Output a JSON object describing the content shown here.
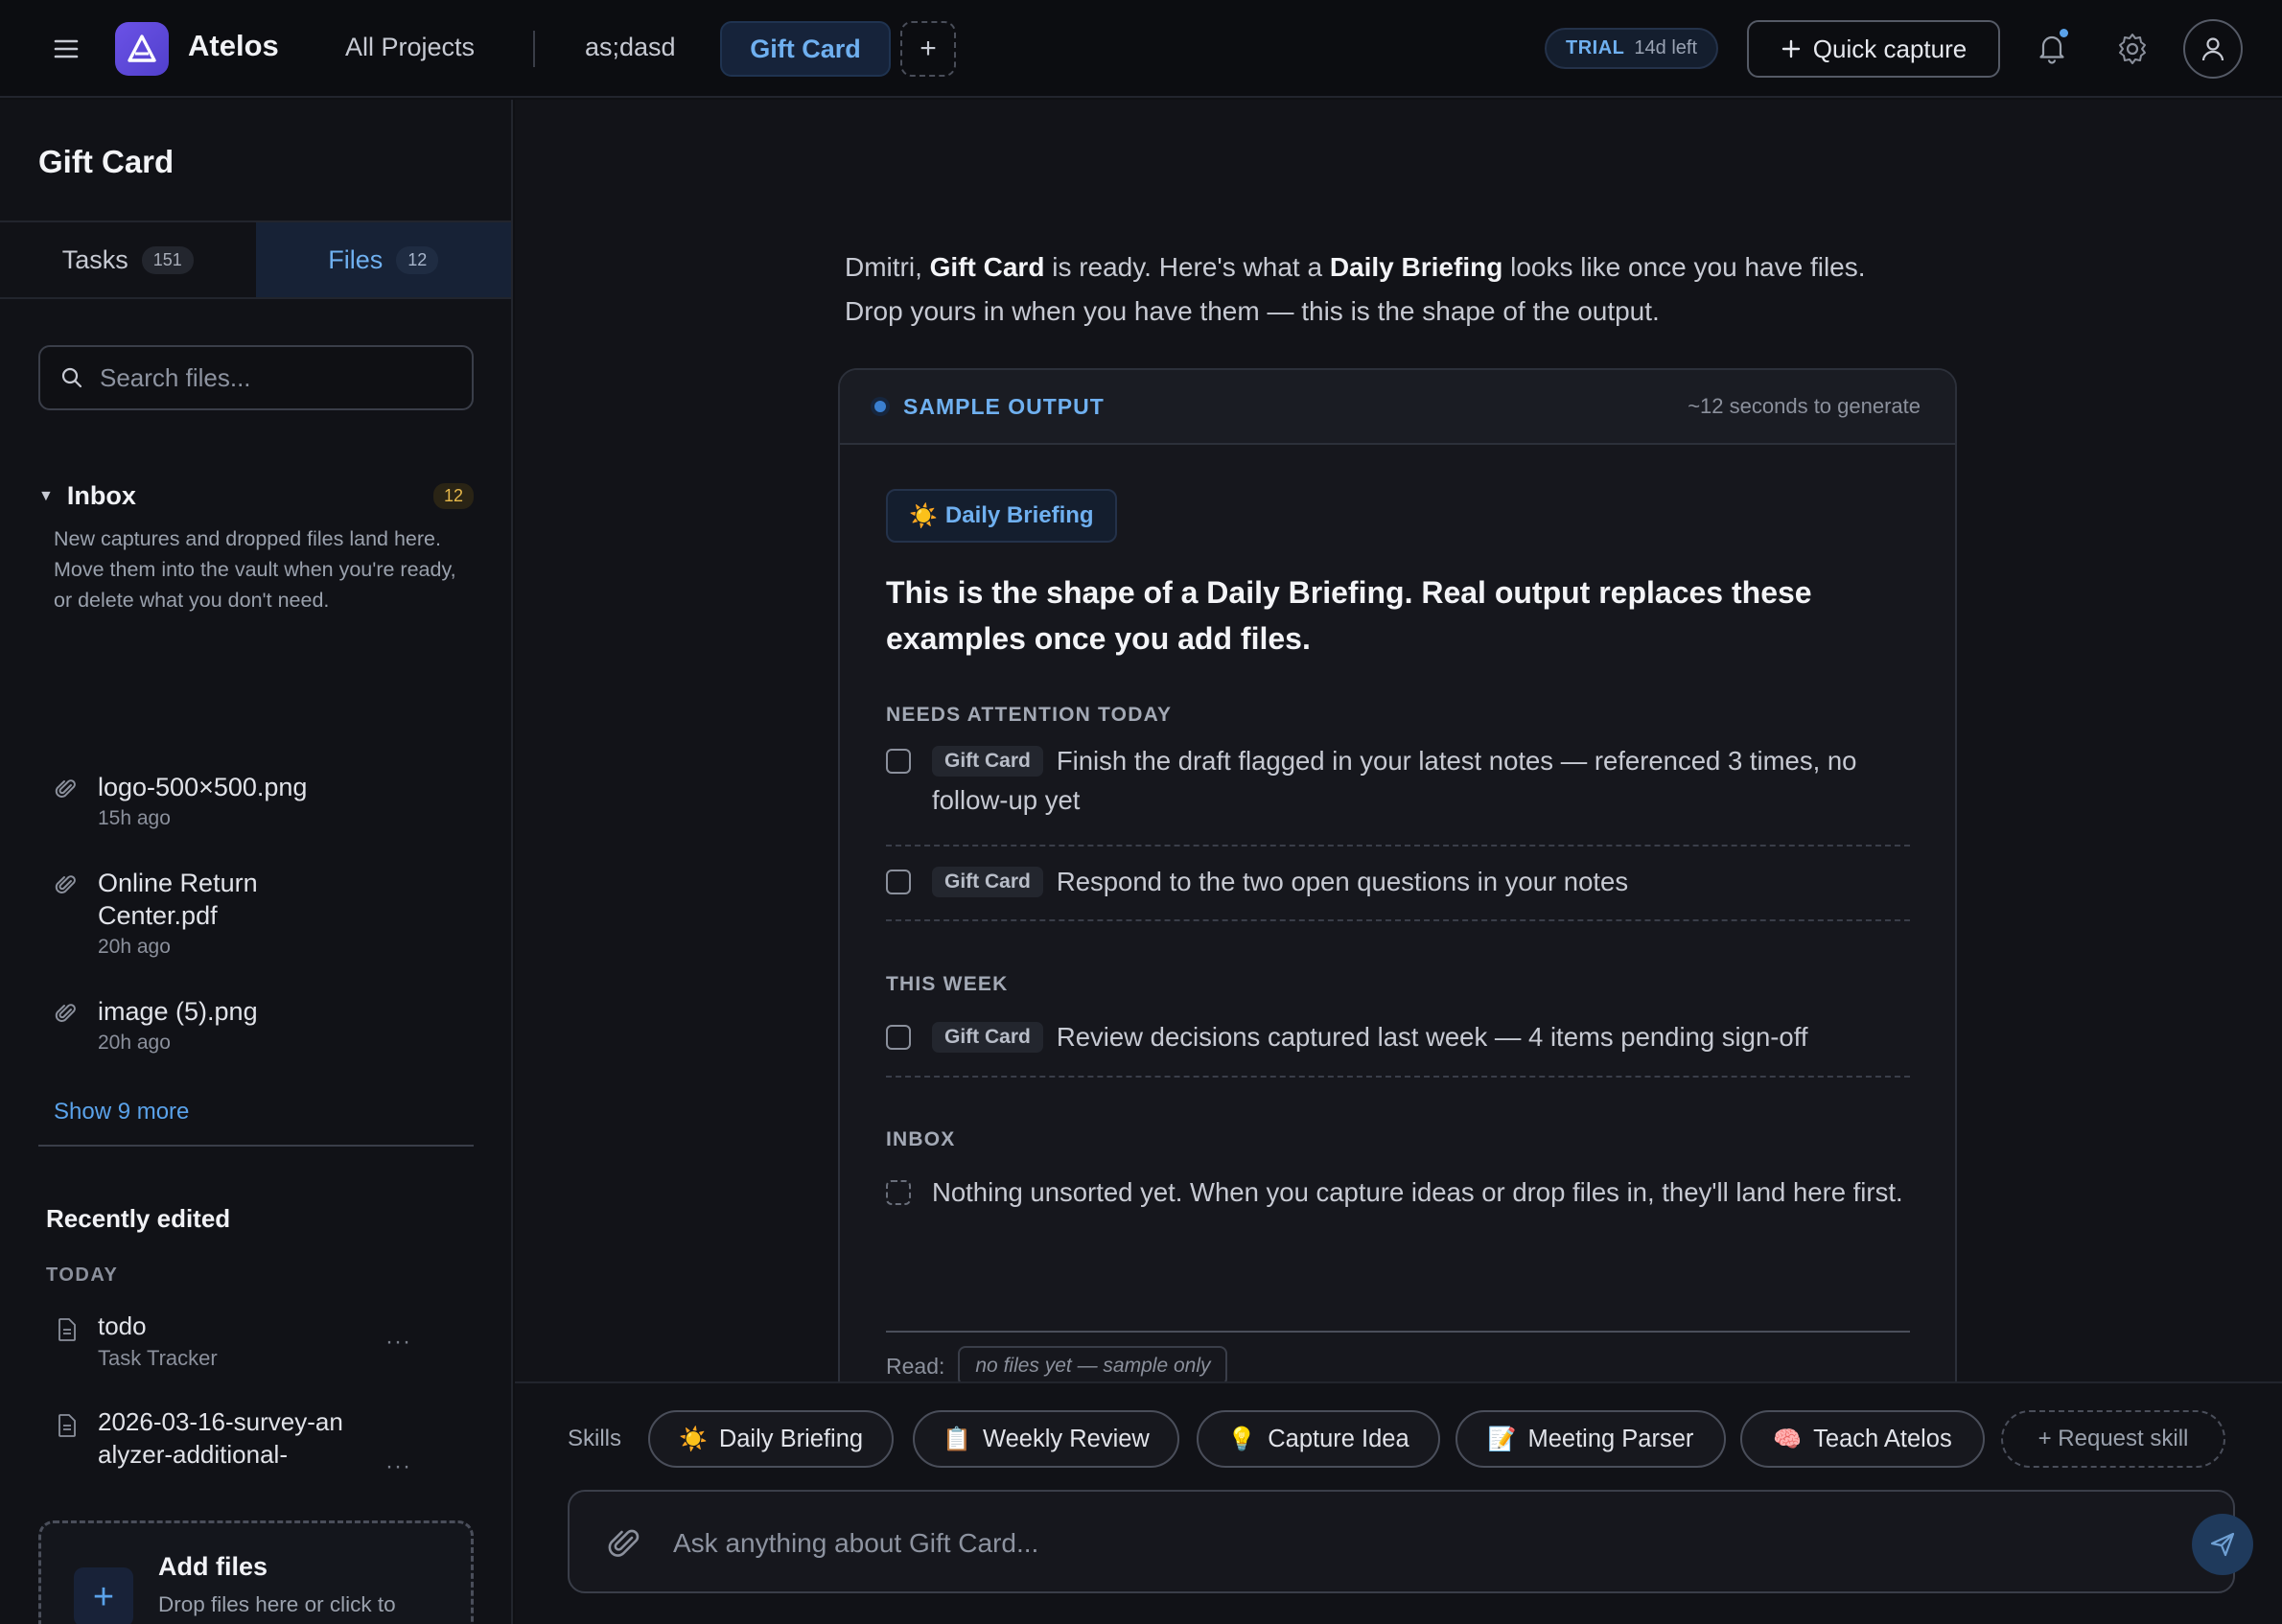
{
  "topbar": {
    "brand": "Atelos",
    "all_projects": "All Projects",
    "project": "as;dasd",
    "active_tab": "Gift Card",
    "add_tab": "+",
    "trial_label": "TRIAL",
    "trial_remaining": "14d left",
    "quick_capture": "Quick capture"
  },
  "sidebar": {
    "title": "Gift Card",
    "tabs": [
      {
        "label": "Tasks",
        "count": "151"
      },
      {
        "label": "Files",
        "count": "12"
      }
    ],
    "search_placeholder": "Search files...",
    "inbox": {
      "title": "Inbox",
      "count": "12",
      "description": "New captures and dropped files land here. Move them into the vault when you're ready, or delete what you don't need.",
      "files": [
        {
          "name": "logo-500×500.png",
          "time": "15h ago"
        },
        {
          "name": "Online Return Center.pdf",
          "time": "20h ago"
        },
        {
          "name": "image (5).png",
          "time": "20h ago"
        }
      ],
      "show_more": "Show 9 more"
    },
    "recent": {
      "title": "Recently edited",
      "group": "TODAY",
      "items": [
        {
          "name": "todo",
          "sub": "Task Tracker",
          "more": "···"
        },
        {
          "name": "2026-03-16-survey-analyzer-additional-",
          "sub": "",
          "more": "···"
        }
      ]
    },
    "add_files": {
      "title": "Add files",
      "subtitle": "Drop files here or click to browse",
      "plus": "+"
    }
  },
  "main": {
    "intro": {
      "name": "Dmitri",
      "sep1": ", ",
      "project": "Gift Card",
      "mid": " is ready. Here's what a ",
      "skill": "Daily Briefing",
      "end": " looks like once you have files.",
      "line2": "Drop yours in when you have them — this is the shape of the output."
    },
    "card": {
      "label": "SAMPLE OUTPUT",
      "generate_time": "~12 seconds to generate",
      "chip_emoji": "☀️",
      "chip": "Daily Briefing",
      "title": "This is the shape of a Daily Briefing. Real output replaces these examples once you add files.",
      "sections": [
        {
          "label": "NEEDS ATTENTION TODAY",
          "tasks": [
            {
              "tag": "Gift Card",
              "text": "Finish the draft flagged in your latest notes — referenced 3 times, no follow-up yet"
            },
            {
              "tag": "Gift Card",
              "text": "Respond to the two open questions in your notes"
            }
          ]
        },
        {
          "label": "THIS WEEK",
          "tasks": [
            {
              "tag": "Gift Card",
              "text": "Review decisions captured last week — 4 items pending sign-off"
            }
          ]
        },
        {
          "label": "INBOX",
          "tasks": [
            {
              "tag": "",
              "text": "Nothing unsorted yet. When you capture ideas or drop files in, they'll land here first."
            }
          ]
        }
      ],
      "read_label": "Read:",
      "read_value": "no files yet — sample only"
    }
  },
  "composer": {
    "skills_label": "Skills",
    "skills": [
      {
        "emoji": "☀️",
        "label": "Daily Briefing"
      },
      {
        "emoji": "📋",
        "label": "Weekly Review"
      },
      {
        "emoji": "💡",
        "label": "Capture Idea"
      },
      {
        "emoji": "📝",
        "label": "Meeting Parser"
      },
      {
        "emoji": "🧠",
        "label": "Teach Atelos"
      }
    ],
    "request_skill": "+ Request skill",
    "ask_placeholder": "Ask anything about Gift Card..."
  },
  "colors": {
    "accent": "#6fb0f0",
    "brand": "#6b52e6",
    "background": "#0f1014",
    "badge": "#e6b84a"
  },
  "icons": [
    "hamburger-icon",
    "logo-icon",
    "plus-icon",
    "bell-icon",
    "gear-icon",
    "user-icon",
    "search-icon",
    "paperclip-icon",
    "document-icon",
    "send-icon"
  ]
}
